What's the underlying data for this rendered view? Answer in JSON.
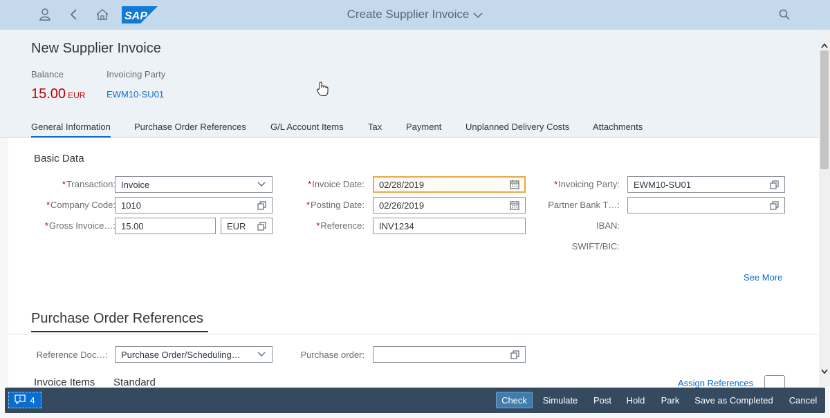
{
  "shell": {
    "title": "Create Supplier Invoice"
  },
  "header": {
    "title": "New Supplier Invoice",
    "balance_label": "Balance",
    "balance_value": "15.00",
    "balance_currency": "EUR",
    "invoicing_party_label": "Invoicing Party",
    "invoicing_party_value": "EWM10-SU01"
  },
  "tabs": [
    {
      "label": "General Information",
      "active": true
    },
    {
      "label": "Purchase Order References"
    },
    {
      "label": "G/L Account Items"
    },
    {
      "label": "Tax"
    },
    {
      "label": "Payment"
    },
    {
      "label": "Unplanned Delivery Costs"
    },
    {
      "label": "Attachments"
    }
  ],
  "basic_data": {
    "title": "Basic Data",
    "transaction": {
      "label": "Transaction:",
      "value": "Invoice"
    },
    "company_code": {
      "label": "Company Code:",
      "value": "1010"
    },
    "gross_invoice": {
      "label": "Gross Invoice…:",
      "value": "15.00",
      "currency": "EUR"
    },
    "invoice_date": {
      "label": "Invoice Date:",
      "value": "02/28/2019"
    },
    "posting_date": {
      "label": "Posting Date:",
      "value": "02/26/2019"
    },
    "reference": {
      "label": "Reference:",
      "value": "INV1234"
    },
    "invoicing_party": {
      "label": "Invoicing Party:",
      "value": "EWM10-SU01"
    },
    "partner_bank": {
      "label": "Partner Bank T…:",
      "value": ""
    },
    "iban": {
      "label": "IBAN:"
    },
    "swift": {
      "label": "SWIFT/BIC:"
    },
    "see_more": "See More"
  },
  "po_references": {
    "title": "Purchase Order References",
    "reference_doc": {
      "label": "Reference Doc…:",
      "value": "Purchase Order/Scheduling…"
    },
    "purchase_order": {
      "label": "Purchase order:",
      "value": ""
    },
    "invoice_items": "Invoice Items",
    "standard": "Standard",
    "assign_references": "Assign References"
  },
  "footer": {
    "message_count": "4",
    "buttons": [
      "Check",
      "Simulate",
      "Post",
      "Hold",
      "Park",
      "Save as Completed",
      "Cancel"
    ]
  },
  "colors": {
    "shell_bg": "#c5d9ec",
    "accent": "#0a6ed1",
    "negative": "#bb0000",
    "footer_bg": "#354a5f",
    "focus_border": "#e9a948"
  }
}
